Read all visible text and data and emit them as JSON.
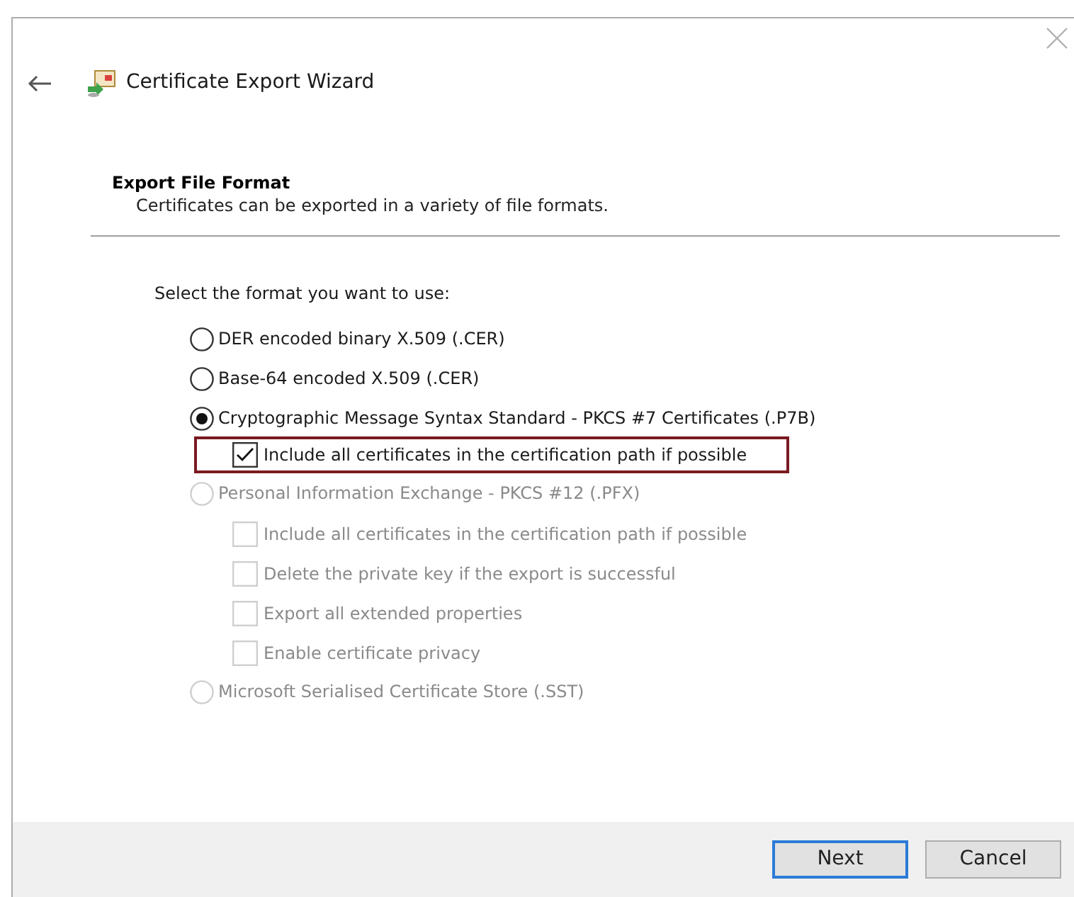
{
  "window": {
    "title": "Certificate Export Wizard"
  },
  "page": {
    "heading": "Export File Format",
    "description": "Certificates can be exported in a variety of file formats."
  },
  "prompt": "Select the format you want to use:",
  "options": [
    {
      "kind": "radio",
      "label": "DER encoded binary X.509 (.CER)",
      "selected": false,
      "disabled": false
    },
    {
      "kind": "radio",
      "label": "Base-64 encoded X.509 (.CER)",
      "selected": false,
      "disabled": false
    },
    {
      "kind": "radio",
      "label": "Cryptographic Message Syntax Standard - PKCS #7 Certificates (.P7B)",
      "selected": true,
      "disabled": false,
      "children": [
        {
          "kind": "checkbox",
          "label": "Include all certificates in the certification path if possible",
          "checked": true,
          "disabled": false,
          "highlighted": true
        }
      ]
    },
    {
      "kind": "radio",
      "label": "Personal Information Exchange - PKCS #12 (.PFX)",
      "selected": false,
      "disabled": true,
      "children": [
        {
          "kind": "checkbox",
          "label": "Include all certificates in the certification path if possible",
          "checked": false,
          "disabled": true,
          "highlighted": false
        },
        {
          "kind": "checkbox",
          "label": "Delete the private key if the export is successful",
          "checked": false,
          "disabled": true,
          "highlighted": false
        },
        {
          "kind": "checkbox",
          "label": "Export all extended properties",
          "checked": false,
          "disabled": true,
          "highlighted": false
        },
        {
          "kind": "checkbox",
          "label": "Enable certificate privacy",
          "checked": false,
          "disabled": true,
          "highlighted": false
        }
      ]
    },
    {
      "kind": "radio",
      "label": "Microsoft Serialised Certificate Store (.SST)",
      "selected": false,
      "disabled": true
    }
  ],
  "buttons": [
    {
      "label": "Next",
      "default": true
    },
    {
      "label": "Cancel",
      "default": false
    }
  ]
}
